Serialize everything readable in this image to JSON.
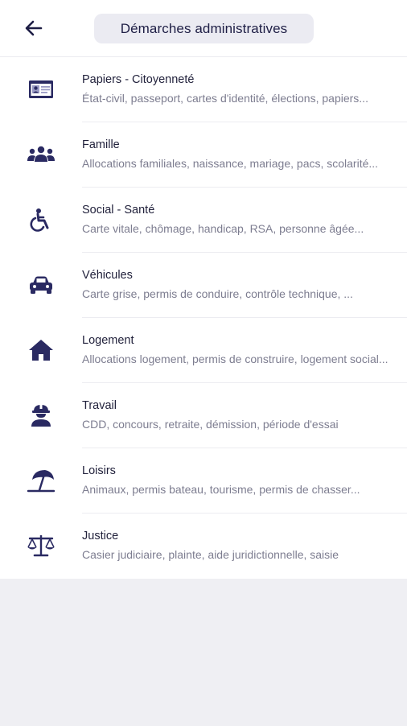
{
  "header": {
    "title": "Démarches administratives",
    "back_icon": "arrow-left-icon"
  },
  "colors": {
    "icon": "#2a2a62",
    "title": "#22223c",
    "subtitle": "#7d7d90",
    "background": "#efeff3"
  },
  "items": [
    {
      "icon": "id-card-icon",
      "title": "Papiers - Citoyenneté",
      "subtitle": "État-civil, passeport, cartes d'identité, élections, papiers..."
    },
    {
      "icon": "family-icon",
      "title": "Famille",
      "subtitle": "Allocations familiales, naissance, mariage, pacs, scolarité..."
    },
    {
      "icon": "accessible-icon",
      "title": "Social - Santé",
      "subtitle": "Carte vitale, chômage, handicap, RSA, personne âgée..."
    },
    {
      "icon": "car-icon",
      "title": "Véhicules",
      "subtitle": "Carte grise, permis de conduire, contrôle technique, ..."
    },
    {
      "icon": "home-icon",
      "title": "Logement",
      "subtitle": "Allocations logement, permis de construire, logement social..."
    },
    {
      "icon": "worker-icon",
      "title": "Travail",
      "subtitle": "CDD, concours, retraite, démission, période d'essai"
    },
    {
      "icon": "beach-umbrella-icon",
      "title": "Loisirs",
      "subtitle": "Animaux, permis bateau, tourisme, permis de chasser..."
    },
    {
      "icon": "scale-icon",
      "title": "Justice",
      "subtitle": "Casier judiciaire, plainte, aide juridictionnelle, saisie"
    }
  ]
}
